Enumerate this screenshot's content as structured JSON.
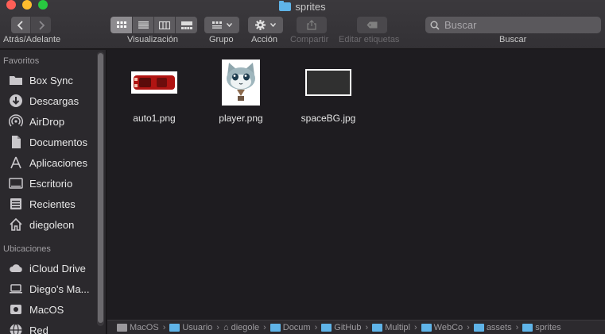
{
  "window": {
    "title": "sprites"
  },
  "toolbar": {
    "back_forward_label": "Atrás/Adelante",
    "view_label": "Visualización",
    "group_label": "Grupo",
    "action_label": "Acción",
    "share_label": "Compartir",
    "tags_label": "Editar etiquetas",
    "search_label": "Buscar",
    "search_placeholder": "Buscar"
  },
  "sidebar": {
    "favorites_header": "Favoritos",
    "favorites": [
      {
        "label": "Box Sync",
        "icon": "folder-icon"
      },
      {
        "label": "Descargas",
        "icon": "download-icon"
      },
      {
        "label": "AirDrop",
        "icon": "airdrop-icon"
      },
      {
        "label": "Documentos",
        "icon": "document-icon"
      },
      {
        "label": "Aplicaciones",
        "icon": "applications-icon"
      },
      {
        "label": "Escritorio",
        "icon": "desktop-icon"
      },
      {
        "label": "Recientes",
        "icon": "recents-icon"
      },
      {
        "label": "diegoleon",
        "icon": "home-icon"
      }
    ],
    "locations_header": "Ubicaciones",
    "locations": [
      {
        "label": "iCloud Drive",
        "icon": "cloud-icon"
      },
      {
        "label": "Diego's Ma...",
        "icon": "laptop-icon"
      },
      {
        "label": "MacOS",
        "icon": "disk-icon"
      },
      {
        "label": "Red",
        "icon": "network-icon"
      }
    ]
  },
  "files": [
    {
      "name": "auto1.png",
      "icon": "car-image-icon"
    },
    {
      "name": "player.png",
      "icon": "cat-image-icon"
    },
    {
      "name": "spaceBG.jpg",
      "icon": "dark-image-icon"
    }
  ],
  "pathbar": [
    {
      "label": "MacOS",
      "icon": "disk-icon"
    },
    {
      "label": "Usuario",
      "icon": "folder-icon"
    },
    {
      "label": "diegole",
      "icon": "home-icon"
    },
    {
      "label": "Docum",
      "icon": "folder-icon"
    },
    {
      "label": "GitHub",
      "icon": "folder-icon"
    },
    {
      "label": "Multipl",
      "icon": "folder-icon"
    },
    {
      "label": "WebCo",
      "icon": "folder-icon"
    },
    {
      "label": "assets",
      "icon": "folder-icon"
    },
    {
      "label": "sprites",
      "icon": "folder-icon"
    }
  ]
}
